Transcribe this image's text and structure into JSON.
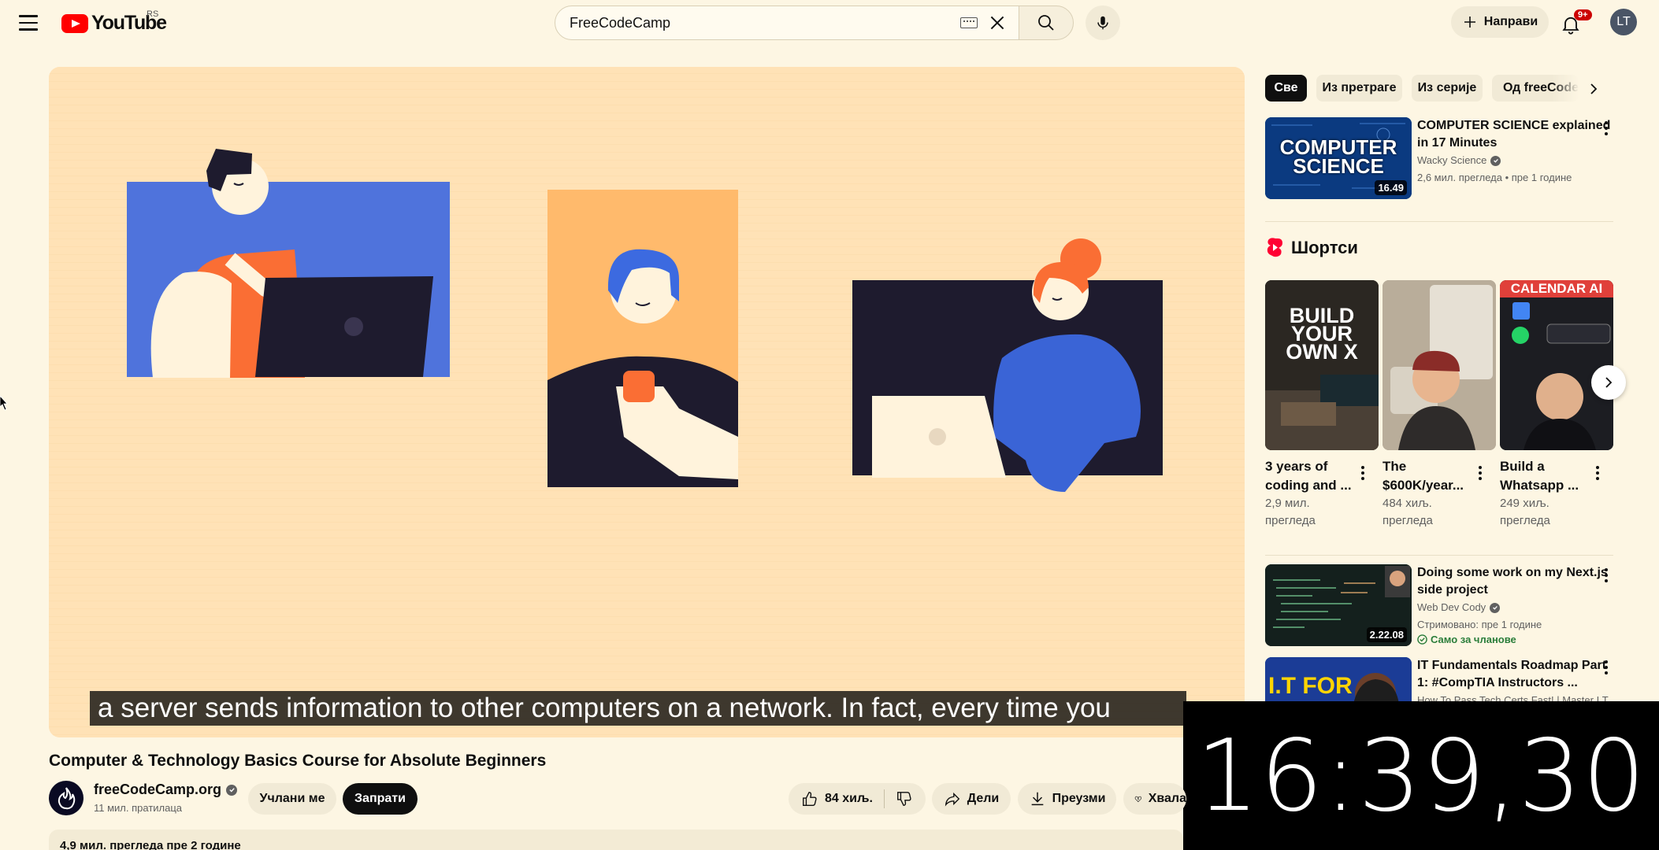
{
  "header": {
    "logo_text": "YouTube",
    "region": "RS",
    "search_value": "FreeCodeCamp",
    "create_label": "Направи",
    "notifications_badge": "9+",
    "avatar_initials": "LT"
  },
  "video": {
    "caption": "a server sends information to other computers on a network. In fact, every time you",
    "title": "Computer & Technology Basics Course for Absolute Beginners",
    "channel": "freeCodeCamp.org",
    "subscribers": "11 мил. пратилаца",
    "join_label": "Учлани ме",
    "subscribe_label": "Запрати",
    "likes": "84 хиљ.",
    "share_label": "Дели",
    "download_label": "Преузми",
    "thanks_label": "Хвала",
    "views_line": "4,9 мил. прегледа  пре 2 године"
  },
  "clock": "16:39,30",
  "sidebar": {
    "chips": [
      "Све",
      "Из претраге",
      "Из серије",
      "Од freeCodeCamp"
    ],
    "related": [
      {
        "title": "COMPUTER SCIENCE explained in 17 Minutes",
        "channel": "Wacky Science",
        "meta": "2,6 мил. прегледа • пре 1 године",
        "duration": "16.49",
        "thumb_text_1": "COMPUTER",
        "thumb_text_2": "SCIENCE"
      },
      {
        "title": "Doing some work on my Next.js side project",
        "channel": "Web Dev Cody",
        "meta": "Стримовано: пре 1 године",
        "duration": "2.22.08",
        "badge": "Само за чланове"
      },
      {
        "title": "IT Fundamentals Roadmap Part 1: #CompTIA Instructors ...",
        "channel": "How To Pass Tech Certs Fast! | Master I.T.",
        "thumb_text": "I.T FOR"
      }
    ],
    "shorts_label": "Шортси",
    "shorts": [
      {
        "title_1": "3 years of",
        "title_2": "coding and ...",
        "views_1": "2,9 мил.",
        "views_2": "прегледа",
        "thumb_text": "BUILD YOUR OWN X"
      },
      {
        "title_1": "The",
        "title_2": "$600K/year...",
        "views_1": "484 хиљ.",
        "views_2": "прегледа"
      },
      {
        "title_1": "Build a",
        "title_2": "Whatsapp ...",
        "views_1": "249 хиљ.",
        "views_2": "прегледа",
        "thumb_text": "CALENDAR AI"
      }
    ]
  }
}
